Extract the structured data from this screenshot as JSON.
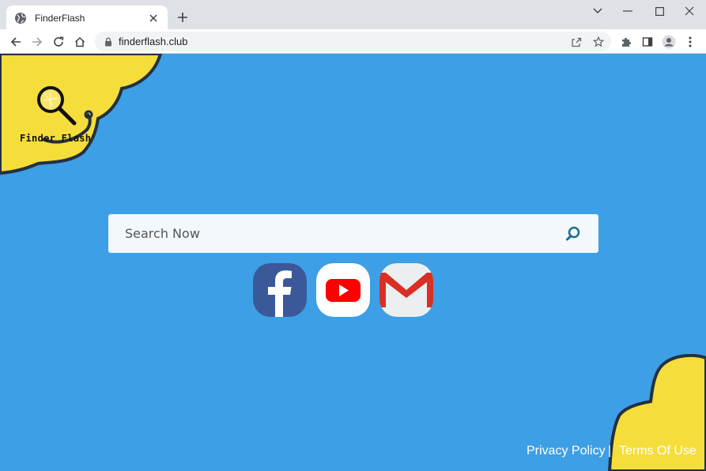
{
  "browser": {
    "tab": {
      "title": "FinderFlash",
      "favicon": "globe-icon"
    },
    "url": "finderflash.club",
    "window_controls": [
      "chevron-down-icon",
      "minimize-icon",
      "maximize-icon",
      "close-icon"
    ]
  },
  "page": {
    "background_color": "#3d9fe5",
    "accent_color": "#f5de3b",
    "logo": {
      "text": "Finder Flash"
    },
    "search": {
      "placeholder": "Search Now"
    },
    "quick_links": [
      {
        "name": "Facebook",
        "color": "#3b5998"
      },
      {
        "name": "YouTube",
        "color": "#ff0000"
      },
      {
        "name": "Gmail",
        "color": "#d93025"
      }
    ],
    "footer": {
      "privacy": "Privacy Policy",
      "separator": "|",
      "terms": "Terms Of Use"
    }
  }
}
